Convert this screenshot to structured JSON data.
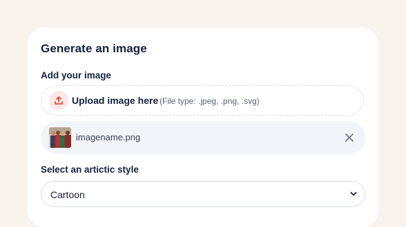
{
  "form": {
    "title": "Generate an image",
    "upload": {
      "label": "Add your image",
      "cta": "Upload image here",
      "hint": "(File type: .jpeg, .png, .svg)",
      "icon": "upload-icon"
    },
    "file": {
      "name": "imagename.png",
      "remove_icon": "close-icon"
    },
    "style": {
      "label": "Select an artictic style",
      "selected": "Cartoon",
      "icon": "chevron-down-icon"
    }
  },
  "colors": {
    "background": "#f9f3ee",
    "card": "#ffffff",
    "heading": "#14213d",
    "upload_accent": "#e5483b",
    "upload_accent_bg": "#fde8e6",
    "file_row_bg": "#f1f4f8",
    "border": "#d9dde3"
  }
}
